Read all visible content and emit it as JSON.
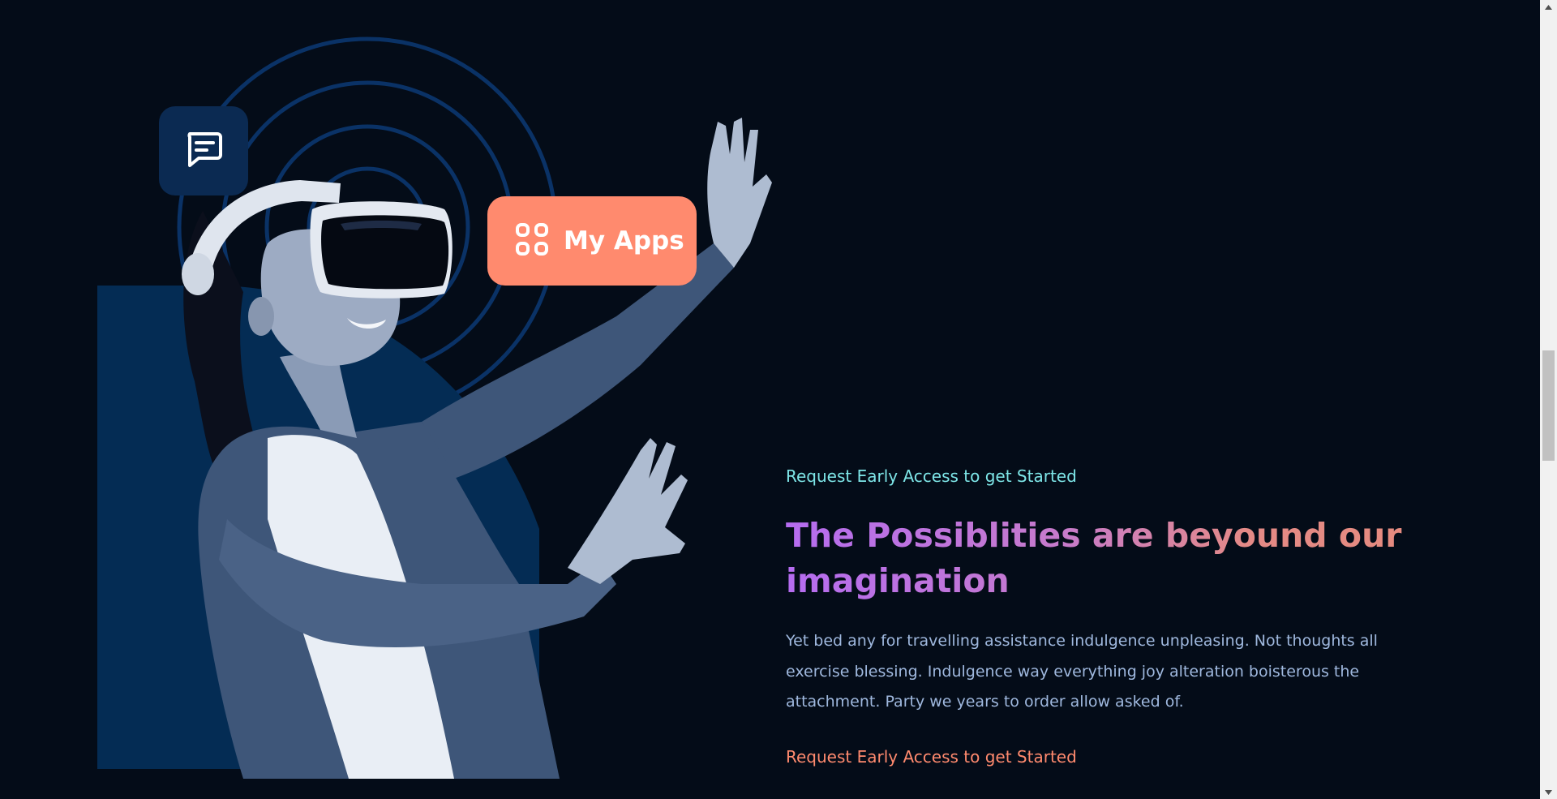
{
  "hero": {
    "apps_badge_label": "My Apps",
    "icons": {
      "chat": "chat-bubble-icon",
      "apps": "apps-grid-icon"
    }
  },
  "content": {
    "eyebrow": "Request Early Access to get Started",
    "headline": "The Possiblities are beyound our imagination",
    "body": "Yet bed any for travelling assistance indulgence unpleasing. Not thoughts all exercise blessing. Indulgence way everything joy alteration boisterous the attachment. Party we years to order allow asked of.",
    "cta_label": "Request Early Access to get Started"
  },
  "colors": {
    "background": "#040c18",
    "accent_cyan": "#7ee6e8",
    "accent_coral": "#ff8a6e",
    "panel_blue": "#042c54",
    "body_text": "#9fb8de"
  },
  "scrollbar": {
    "up_icon": "scroll-up-arrow-icon",
    "down_icon": "scroll-down-arrow-icon"
  }
}
